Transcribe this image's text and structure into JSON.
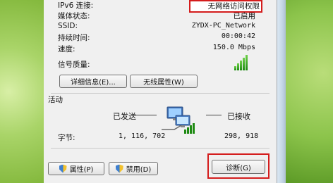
{
  "info": {
    "ipv6_label": "IPv6 连接:",
    "ipv6_value": "无网络访问权限",
    "media_label": "媒体状态:",
    "media_value": "已启用",
    "ssid_label": "SSID:",
    "ssid_value": "ZYDX-PC_Network",
    "duration_label": "持续时间:",
    "duration_value": "00:00:42",
    "speed_label": "速度:",
    "speed_value": "150.0 Mbps",
    "signal_label": "信号质量:",
    "signal_bars": 5,
    "signal_color": "#2ea318"
  },
  "buttons": {
    "details": "详细信息(E)...",
    "wireless_props": "无线属性(W)"
  },
  "activity": {
    "title": "活动",
    "sent_label": "已发送",
    "received_label": "已接收",
    "bytes_label": "字节:",
    "sent_bytes": "1, 116, 702",
    "received_bytes": "298, 918"
  },
  "bottom_buttons": {
    "properties": "属性(P)",
    "disable": "禁用(D)",
    "diagnose": "诊断(G)"
  },
  "colors": {
    "highlight": "#d41c1c"
  }
}
